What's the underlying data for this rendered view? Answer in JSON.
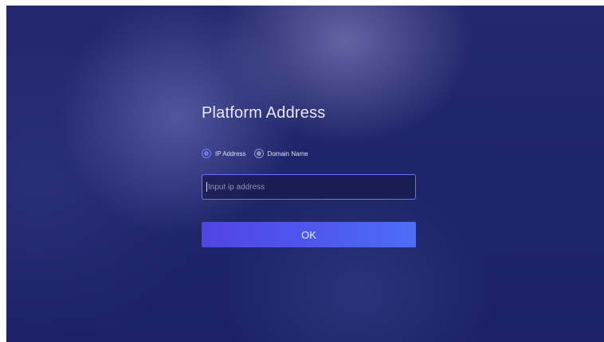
{
  "form": {
    "title": "Platform Address",
    "address_type": {
      "options": [
        {
          "label": "IP Address",
          "selected": true
        },
        {
          "label": "Domain Name",
          "selected": false
        }
      ]
    },
    "input": {
      "value": "",
      "placeholder": "Input ip address"
    },
    "submit_label": "OK"
  },
  "colors": {
    "background": "#1f256a",
    "accent": "#6f74f0",
    "button_start": "#5144e6",
    "button_end": "#4c6ef7"
  }
}
